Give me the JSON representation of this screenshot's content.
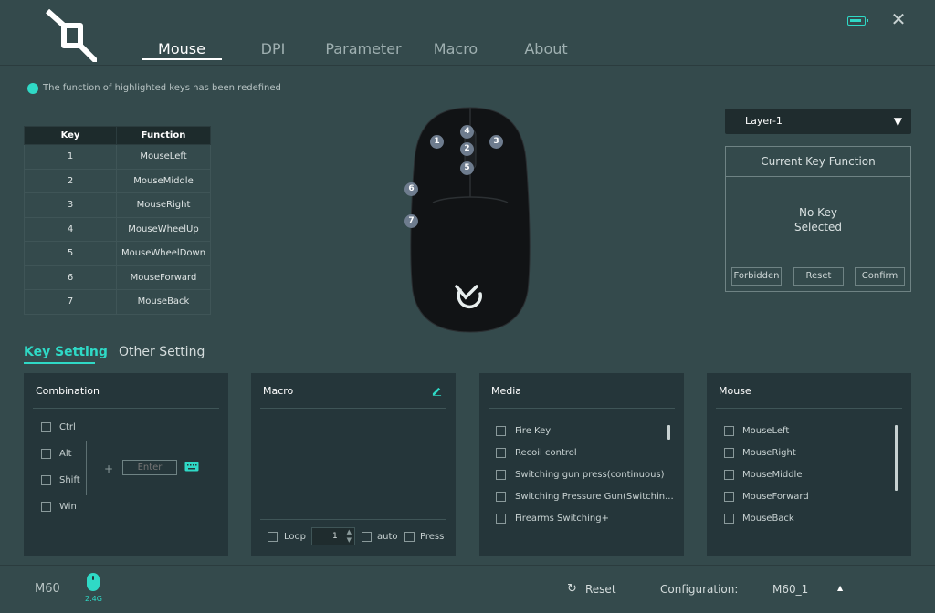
{
  "header": {
    "tabs": [
      {
        "label": "Mouse",
        "active": true
      },
      {
        "label": "DPI",
        "active": false
      },
      {
        "label": "Parameter",
        "active": false
      },
      {
        "label": "Macro",
        "active": false
      },
      {
        "label": "About",
        "active": false
      }
    ],
    "icons": {
      "logo": "brand-logo",
      "battery": "battery-icon",
      "close": "close-icon"
    },
    "accent_color": "#2fd9c6"
  },
  "notice": {
    "text": "The function of highlighted keys has been redefined"
  },
  "key_table": {
    "headers": [
      "Key",
      "Function"
    ],
    "rows": [
      [
        "1",
        "MouseLeft"
      ],
      [
        "2",
        "MouseMiddle"
      ],
      [
        "3",
        "MouseRight"
      ],
      [
        "4",
        "MouseWheelUp"
      ],
      [
        "5",
        "MouseWheelDown"
      ],
      [
        "6",
        "MouseForward"
      ],
      [
        "7",
        "MouseBack"
      ]
    ]
  },
  "mouse_markers": [
    "1",
    "2",
    "3",
    "4",
    "5",
    "6",
    "7"
  ],
  "right_panel": {
    "layer": "Layer-1",
    "current_key_title": "Current Key Function",
    "no_key_line1": "No Key",
    "no_key_line2": "Selected",
    "buttons": {
      "forbidden": "Forbidden",
      "reset": "Reset",
      "confirm": "Confirm"
    }
  },
  "settings_tabs": {
    "key_setting": "Key Setting",
    "other_setting": "Other Setting"
  },
  "panels": {
    "combination": {
      "title": "Combination",
      "modifiers": [
        "Ctrl",
        "Alt",
        "Shift",
        "Win"
      ],
      "plus": "+",
      "input_placeholder": "Enter"
    },
    "macro": {
      "title": "Macro",
      "loop": "Loop",
      "loop_count": "1",
      "auto": "auto",
      "press": "Press"
    },
    "media": {
      "title": "Media",
      "items": [
        "Fire Key",
        "Recoil control",
        "Switching gun press(continuous)",
        "Switching Pressure Gun(Switchin...",
        "Firearms Switching+"
      ]
    },
    "mouse": {
      "title": "Mouse",
      "items": [
        "MouseLeft",
        "MouseRight",
        "MouseMiddle",
        "MouseForward",
        "MouseBack"
      ]
    }
  },
  "footer": {
    "device_name": "M60",
    "connection": "2.4G",
    "reset_label": "Reset",
    "config_label": "Configuration:",
    "config_value": "M60_1"
  }
}
